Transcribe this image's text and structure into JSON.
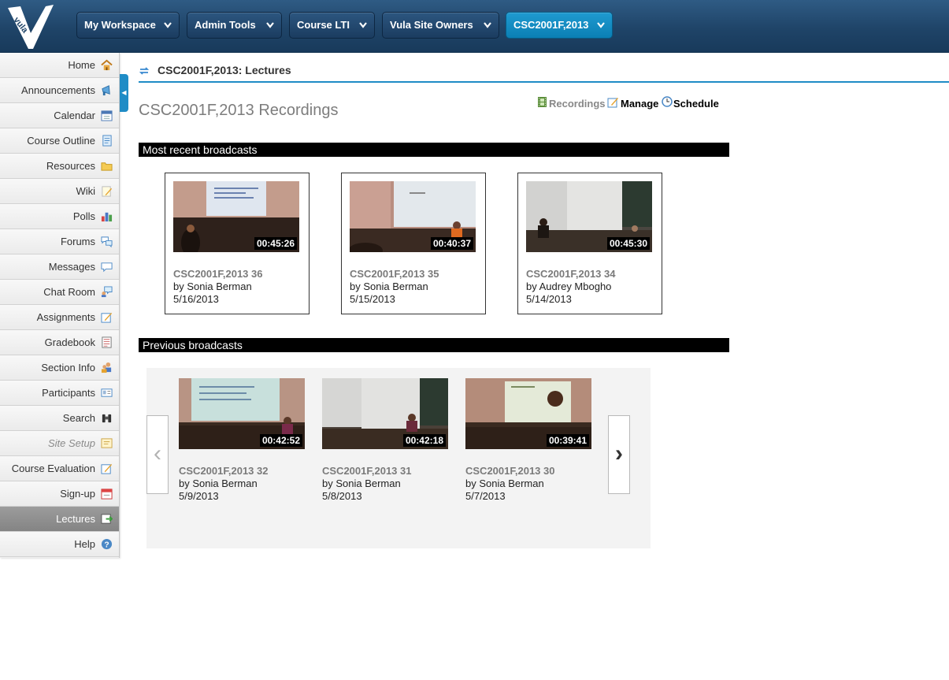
{
  "header": {
    "logo_text": "vula",
    "site_tabs": [
      {
        "label": "My Workspace",
        "active": false
      },
      {
        "label": "Admin Tools",
        "active": false
      },
      {
        "label": "Course LTI",
        "active": false
      },
      {
        "label": "Vula Site Owners",
        "active": false
      },
      {
        "label": "CSC2001F,2013",
        "active": true
      }
    ]
  },
  "sidebar": {
    "items": [
      {
        "label": "Home",
        "icon": "home-icon"
      },
      {
        "label": "Announcements",
        "icon": "megaphone-icon"
      },
      {
        "label": "Calendar",
        "icon": "calendar-icon"
      },
      {
        "label": "Course Outline",
        "icon": "scroll-icon"
      },
      {
        "label": "Resources",
        "icon": "folder-icon"
      },
      {
        "label": "Wiki",
        "icon": "pencil-icon"
      },
      {
        "label": "Polls",
        "icon": "bar-chart-icon"
      },
      {
        "label": "Forums",
        "icon": "speech-bubbles-icon"
      },
      {
        "label": "Messages",
        "icon": "speech-bubble-icon"
      },
      {
        "label": "Chat Room",
        "icon": "chat-icon"
      },
      {
        "label": "Assignments",
        "icon": "edit-icon"
      },
      {
        "label": "Gradebook",
        "icon": "gradebook-icon"
      },
      {
        "label": "Section Info",
        "icon": "users-icon"
      },
      {
        "label": "Participants",
        "icon": "id-card-icon"
      },
      {
        "label": "Search",
        "icon": "binoculars-icon"
      },
      {
        "label": "Site Setup",
        "icon": "setup-icon",
        "disabled": true
      },
      {
        "label": "Course Evaluation",
        "icon": "evaluation-icon"
      },
      {
        "label": "Sign-up",
        "icon": "signup-calendar-icon"
      },
      {
        "label": "Lectures",
        "icon": "lectures-icon",
        "selected": true
      },
      {
        "label": "Help",
        "icon": "help-icon"
      }
    ]
  },
  "tool": {
    "title": "CSC2001F,2013: Lectures"
  },
  "main": {
    "heading": "CSC2001F,2013 Recordings",
    "toolbar": {
      "recordings": "Recordings",
      "manage": "Manage",
      "schedule": "Schedule"
    },
    "recent_title": "Most recent broadcasts",
    "recent": [
      {
        "title": "CSC2001F,2013 36",
        "author": "by Sonia Berman",
        "date": "5/16/2013",
        "duration": "00:45:26"
      },
      {
        "title": "CSC2001F,2013 35",
        "author": "by Sonia Berman",
        "date": "5/15/2013",
        "duration": "00:40:37"
      },
      {
        "title": "CSC2001F,2013 34",
        "author": "by Audrey Mbogho",
        "date": "5/14/2013",
        "duration": "00:45:30"
      }
    ],
    "previous_title": "Previous broadcasts",
    "previous": [
      {
        "title": "CSC2001F,2013 32",
        "author": "by Sonia Berman",
        "date": "5/9/2013",
        "duration": "00:42:52"
      },
      {
        "title": "CSC2001F,2013 31",
        "author": "by Sonia Berman",
        "date": "5/8/2013",
        "duration": "00:42:18"
      },
      {
        "title": "CSC2001F,2013 30",
        "author": "by Sonia Berman",
        "date": "5/7/2013",
        "duration": "00:39:41"
      }
    ],
    "carousel": {
      "prev": "‹",
      "next": "›"
    }
  },
  "colors": {
    "accent": "#1f8cc6",
    "header": "#1f4468",
    "active_tab": "#0b7fb4"
  }
}
